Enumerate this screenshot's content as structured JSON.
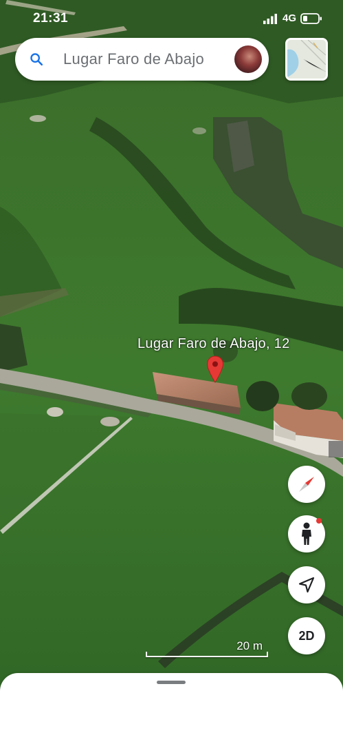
{
  "status_bar": {
    "time": "21:31",
    "network": "4G",
    "icons": [
      "signal-icon",
      "battery-icon"
    ]
  },
  "search": {
    "query": "Lugar Faro de Abajo",
    "icon": "search-icon",
    "avatar": "user-avatar"
  },
  "map": {
    "view": "3D satellite",
    "place_label": "Lugar Faro de Abajo, 12",
    "pin_color": "#e53935",
    "scale_label": "20 m"
  },
  "controls": {
    "compass_icon": "compass-icon",
    "pegman_icon": "pegman-icon",
    "location_icon": "my-location-icon",
    "view_toggle_label": "2D"
  },
  "colors": {
    "accent": "#1a73e8",
    "pin": "#e53935",
    "grass": "#3f7a2e"
  }
}
